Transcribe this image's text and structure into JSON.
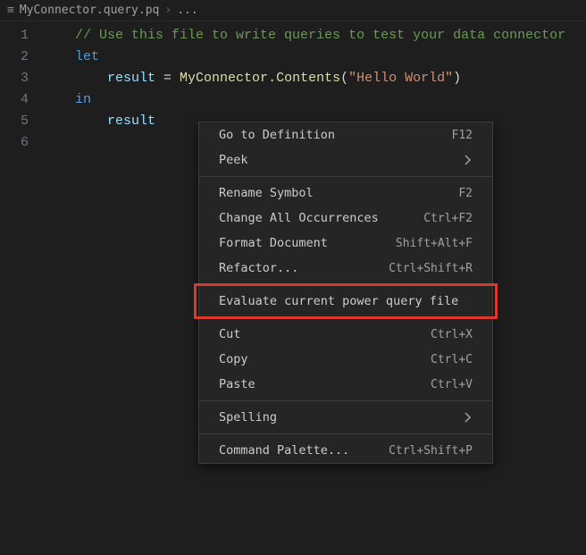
{
  "breadcrumb": {
    "file_icon": "≡",
    "file": "MyConnector.query.pq",
    "sep": "›",
    "crumb": "..."
  },
  "code": {
    "lines": [
      {
        "n": "1",
        "tokens": [
          {
            "cls": "tok-punct",
            "t": "    "
          },
          {
            "cls": "tok-comment",
            "t": "// Use this file to write queries to test your data connector"
          }
        ]
      },
      {
        "n": "2",
        "tokens": [
          {
            "cls": "tok-punct",
            "t": "    "
          },
          {
            "cls": "tok-keyword",
            "t": "let"
          }
        ]
      },
      {
        "n": "3",
        "tokens": [
          {
            "cls": "tok-punct",
            "t": "        "
          },
          {
            "cls": "tok-ident",
            "t": "result"
          },
          {
            "cls": "tok-punct",
            "t": " = "
          },
          {
            "cls": "tok-func",
            "t": "MyConnector.Contents"
          },
          {
            "cls": "tok-punct",
            "t": "("
          },
          {
            "cls": "tok-string",
            "t": "\"Hello World\""
          },
          {
            "cls": "tok-punct",
            "t": ")"
          }
        ]
      },
      {
        "n": "4",
        "tokens": [
          {
            "cls": "tok-punct",
            "t": "    "
          },
          {
            "cls": "tok-keyword",
            "t": "in"
          }
        ]
      },
      {
        "n": "5",
        "tokens": [
          {
            "cls": "tok-punct",
            "t": "        "
          },
          {
            "cls": "tok-ident",
            "t": "result"
          }
        ]
      },
      {
        "n": "6",
        "tokens": []
      }
    ]
  },
  "menu": {
    "groups": [
      [
        {
          "label": "Go to Definition",
          "shortcut": "F12",
          "name": "go-to-definition"
        },
        {
          "label": "Peek",
          "submenu": true,
          "name": "peek"
        }
      ],
      [
        {
          "label": "Rename Symbol",
          "shortcut": "F2",
          "name": "rename-symbol"
        },
        {
          "label": "Change All Occurrences",
          "shortcut": "Ctrl+F2",
          "name": "change-all-occurrences"
        },
        {
          "label": "Format Document",
          "shortcut": "Shift+Alt+F",
          "name": "format-document"
        },
        {
          "label": "Refactor...",
          "shortcut": "Ctrl+Shift+R",
          "name": "refactor"
        }
      ],
      [
        {
          "label": "Evaluate current power query file",
          "name": "evaluate-power-query",
          "highlight": true
        }
      ],
      [
        {
          "label": "Cut",
          "shortcut": "Ctrl+X",
          "name": "cut"
        },
        {
          "label": "Copy",
          "shortcut": "Ctrl+C",
          "name": "copy"
        },
        {
          "label": "Paste",
          "shortcut": "Ctrl+V",
          "name": "paste"
        }
      ],
      [
        {
          "label": "Spelling",
          "submenu": true,
          "name": "spelling"
        }
      ],
      [
        {
          "label": "Command Palette...",
          "shortcut": "Ctrl+Shift+P",
          "name": "command-palette"
        }
      ]
    ]
  }
}
